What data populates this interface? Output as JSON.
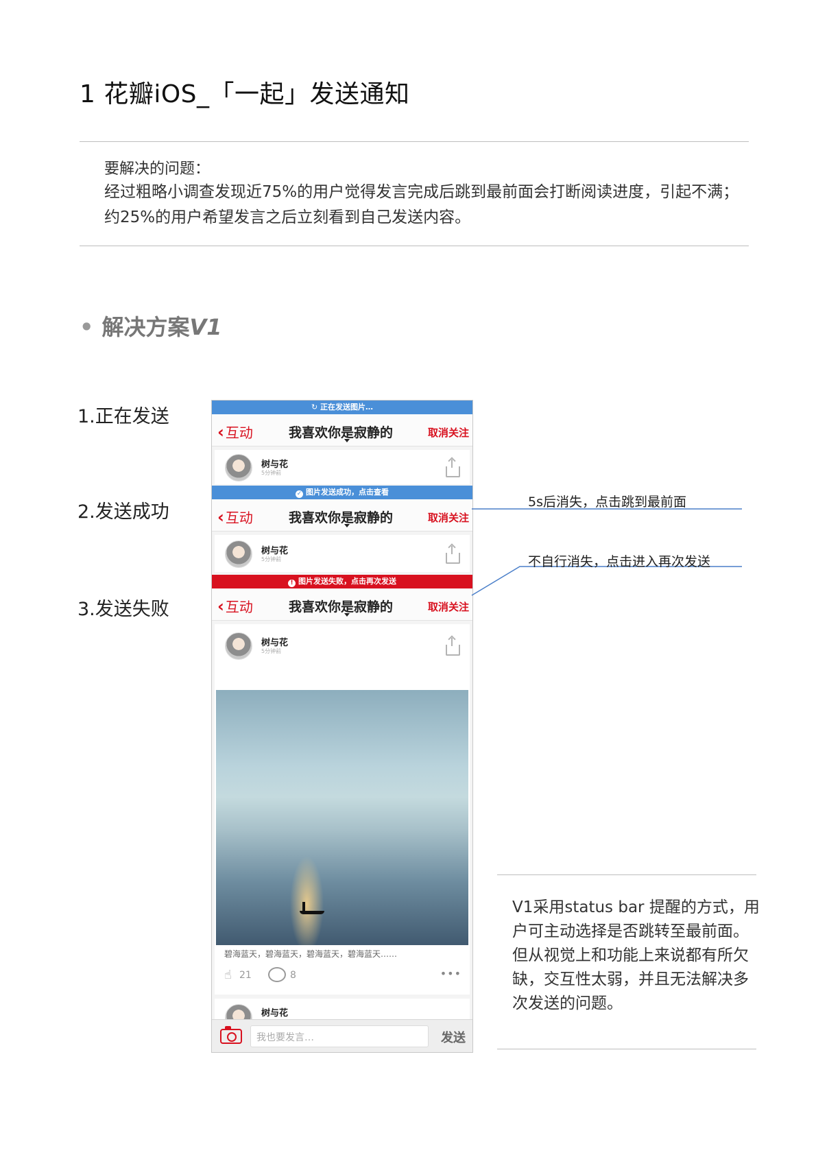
{
  "page": {
    "title": "1 花瓣iOS_「一起」发送通知",
    "problem_label": "要解决的问题：",
    "problem_text": "经过粗略小调查发现近75%的用户觉得发言完成后跳到最前面会打断阅读进度，引起不满；约25%的用户希望发言之后立刻看到自己发送内容。"
  },
  "section": {
    "bullet": "•",
    "title_prefix": "解决方案",
    "title_version": "V1"
  },
  "steps": {
    "sending": "1.正在发送",
    "success": "2.发送成功",
    "failed": "3.发送失败"
  },
  "phone": {
    "status_sending": "正在发送图片…",
    "status_success": "图片发送成功，点击查看",
    "status_failed": "图片发送失败，点击再次发送",
    "nav_back": "互动",
    "nav_title": "我喜欢你是寂静的",
    "nav_action": "取消关注",
    "post_user": "树与花",
    "post_time": "5分钟前",
    "caption": "碧海蓝天，碧海蓝天，碧海蓝天，碧海蓝天……",
    "like_count": "21",
    "comment_count": "8",
    "more": "•••",
    "input_placeholder": "我也要发言…",
    "send_label": "发送"
  },
  "annotations": {
    "success_note": "5s后消失，点击跳到最前面",
    "failed_note": "不自行消失，点击进入再次发送"
  },
  "note": {
    "text": "V1采用status bar 提醒的方式，用户可主动选择是否跳转至最前面。但从视觉上和功能上来说都有所欠缺，交互性太弱，并且无法解决多次发送的问题。"
  },
  "colors": {
    "brand_red": "#d8111f",
    "status_blue": "#4a8fd8",
    "annotation_line": "#4a7fc9"
  }
}
